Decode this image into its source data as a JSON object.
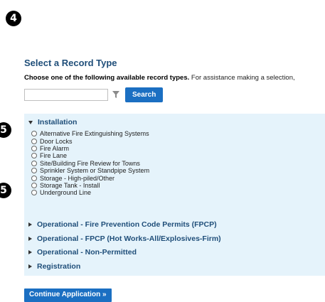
{
  "badges": {
    "step_top": "4",
    "step_installation": "5",
    "step_options": "5"
  },
  "page_title": "Select a Record Type",
  "instructions": {
    "bold": "Choose one of the following available record types.",
    "normal": " For assistance making a selection,"
  },
  "search": {
    "value": "",
    "placeholder": "",
    "button_label": "Search"
  },
  "categories": [
    {
      "label": "Installation",
      "expanded": true,
      "options": [
        "Alternative Fire Extinguishing Systems",
        "Door Locks",
        "Fire Alarm",
        "Fire Lane",
        "Site/Building Fire Review for Towns",
        "Sprinkler System or Standpipe System",
        "Storage - High-piled/Other",
        "Storage Tank - Install",
        "Underground Line"
      ]
    },
    {
      "label": "Operational - Fire Prevention Code Permits (FPCP)",
      "expanded": false
    },
    {
      "label": "Operational - FPCP (Hot Works-All/Explosives-Firm)",
      "expanded": false
    },
    {
      "label": "Operational - Non-Permitted",
      "expanded": false
    },
    {
      "label": "Registration",
      "expanded": false
    }
  ],
  "continue_label": "Continue Application »",
  "colors": {
    "accent": "#1b6fc2",
    "heading": "#1f4e79",
    "panel_bg": "#e5f3fb"
  }
}
